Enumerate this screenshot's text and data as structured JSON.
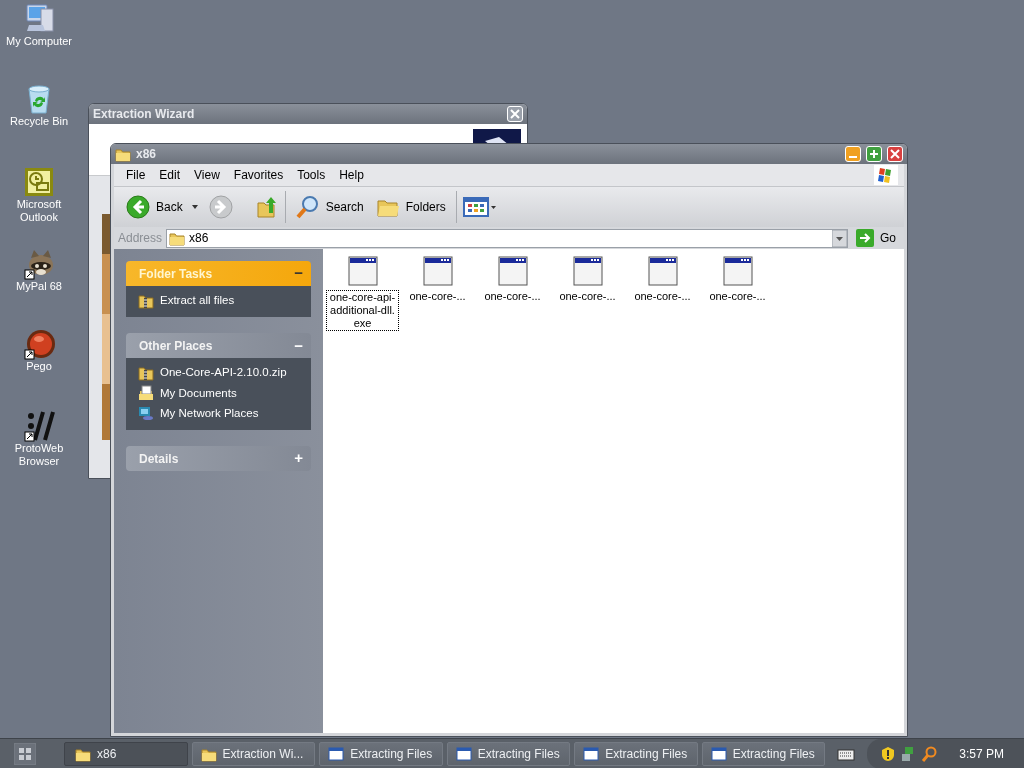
{
  "desktop_icons": [
    {
      "label": "My Computer",
      "kind": "computer"
    },
    {
      "label": "Recycle Bin",
      "kind": "bin"
    },
    {
      "label": "Microsoft Outlook",
      "kind": "outlook"
    },
    {
      "label": "MyPal 68",
      "kind": "raccoon"
    },
    {
      "label": "Pego",
      "kind": "orb"
    },
    {
      "label": "ProtoWeb Browser",
      "kind": "slashes"
    }
  ],
  "wizard": {
    "title": "Extraction Wizard"
  },
  "explorer": {
    "title": "x86",
    "menu": [
      "File",
      "Edit",
      "View",
      "Favorites",
      "Tools",
      "Help"
    ],
    "toolbar": {
      "back": "Back",
      "search": "Search",
      "folders": "Folders"
    },
    "address": {
      "label": "Address",
      "value": "x86",
      "go": "Go"
    },
    "panels": [
      {
        "title": "Folder Tasks",
        "kind": "tasks",
        "expanded": true,
        "toggle": "−",
        "items": [
          {
            "label": "Extract all files",
            "kind": "zip"
          }
        ]
      },
      {
        "title": "Other Places",
        "kind": "places",
        "expanded": true,
        "toggle": "−",
        "items": [
          {
            "label": "One-Core-API-2.10.0.zip",
            "kind": "zip"
          },
          {
            "label": "My Documents",
            "kind": "docs"
          },
          {
            "label": "My Network Places",
            "kind": "network"
          }
        ]
      },
      {
        "title": "Details",
        "kind": "places",
        "expanded": false,
        "toggle": "+"
      }
    ],
    "files": [
      {
        "label": "one-core-api-additional-dll.exe",
        "selected": true
      },
      {
        "label": "one-core-...",
        "selected": false
      },
      {
        "label": "one-core-...",
        "selected": false
      },
      {
        "label": "one-core-...",
        "selected": false
      },
      {
        "label": "one-core-...",
        "selected": false
      },
      {
        "label": "one-core-...",
        "selected": false
      }
    ]
  },
  "taskbar": {
    "buttons": [
      {
        "label": "x86",
        "kind": "folder",
        "selected": true
      },
      {
        "label": "Extraction Wi...",
        "kind": "folder",
        "selected": false
      },
      {
        "label": "Extracting Files",
        "kind": "window",
        "selected": false
      },
      {
        "label": "Extracting Files",
        "kind": "window",
        "selected": false
      },
      {
        "label": "Extracting Files",
        "kind": "window",
        "selected": false
      },
      {
        "label": "Extracting Files",
        "kind": "window",
        "selected": false
      }
    ],
    "clock": "3:57 PM"
  }
}
